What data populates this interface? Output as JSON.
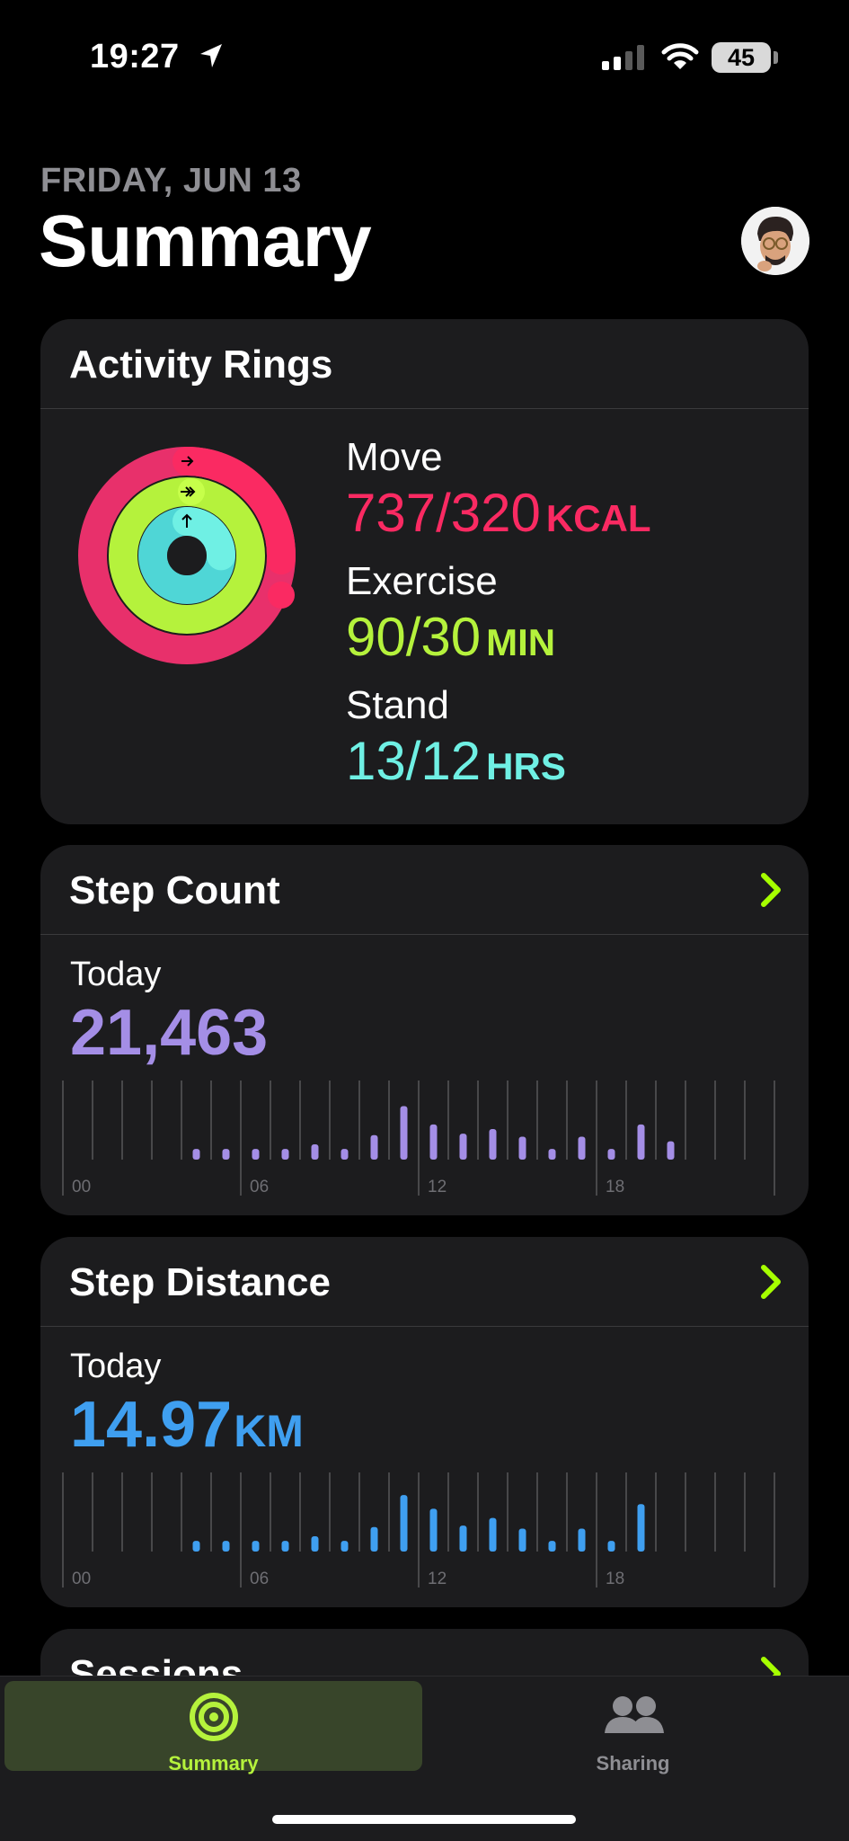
{
  "status": {
    "time": "19:27",
    "battery": "45"
  },
  "header": {
    "date": "FRIDAY, JUN 13",
    "title": "Summary"
  },
  "activity": {
    "title": "Activity Rings",
    "move": {
      "label": "Move",
      "value": "737/320",
      "unit": "KCAL",
      "progress": 2.3
    },
    "exercise": {
      "label": "Exercise",
      "value": "90/30",
      "unit": "MIN",
      "progress": 3.0
    },
    "stand": {
      "label": "Stand",
      "value": "13/12",
      "unit": "HRS",
      "progress": 1.08
    }
  },
  "steps": {
    "title": "Step Count",
    "period": "Today",
    "value": "21,463",
    "x_ticks": [
      "00",
      "06",
      "12",
      "18"
    ],
    "hourly": [
      0,
      0,
      0,
      0,
      0.14,
      0.14,
      0.14,
      0.14,
      0.2,
      0.14,
      0.32,
      0.7,
      0.46,
      0.34,
      0.4,
      0.3,
      0.14,
      0.3,
      0.14,
      0.46,
      0.24,
      0,
      0,
      0,
      0
    ]
  },
  "distance": {
    "title": "Step Distance",
    "period": "Today",
    "value": "14.97",
    "unit": "KM",
    "x_ticks": [
      "00",
      "06",
      "12",
      "18"
    ],
    "hourly": [
      0,
      0,
      0,
      0,
      0.14,
      0.14,
      0.14,
      0.14,
      0.2,
      0.14,
      0.32,
      0.74,
      0.56,
      0.34,
      0.44,
      0.3,
      0.14,
      0.3,
      0.14,
      0.62,
      0,
      0,
      0,
      0,
      0
    ]
  },
  "sessions": {
    "title": "Sessions"
  },
  "tabs": {
    "summary": "Summary",
    "sharing": "Sharing"
  },
  "colors": {
    "move": "#fa114f",
    "exercise": "#a6ff00",
    "stand": "#00f5ea",
    "steps": "#a48ee6",
    "distance": "#3f9ff0",
    "accent": "#a6ff00"
  }
}
